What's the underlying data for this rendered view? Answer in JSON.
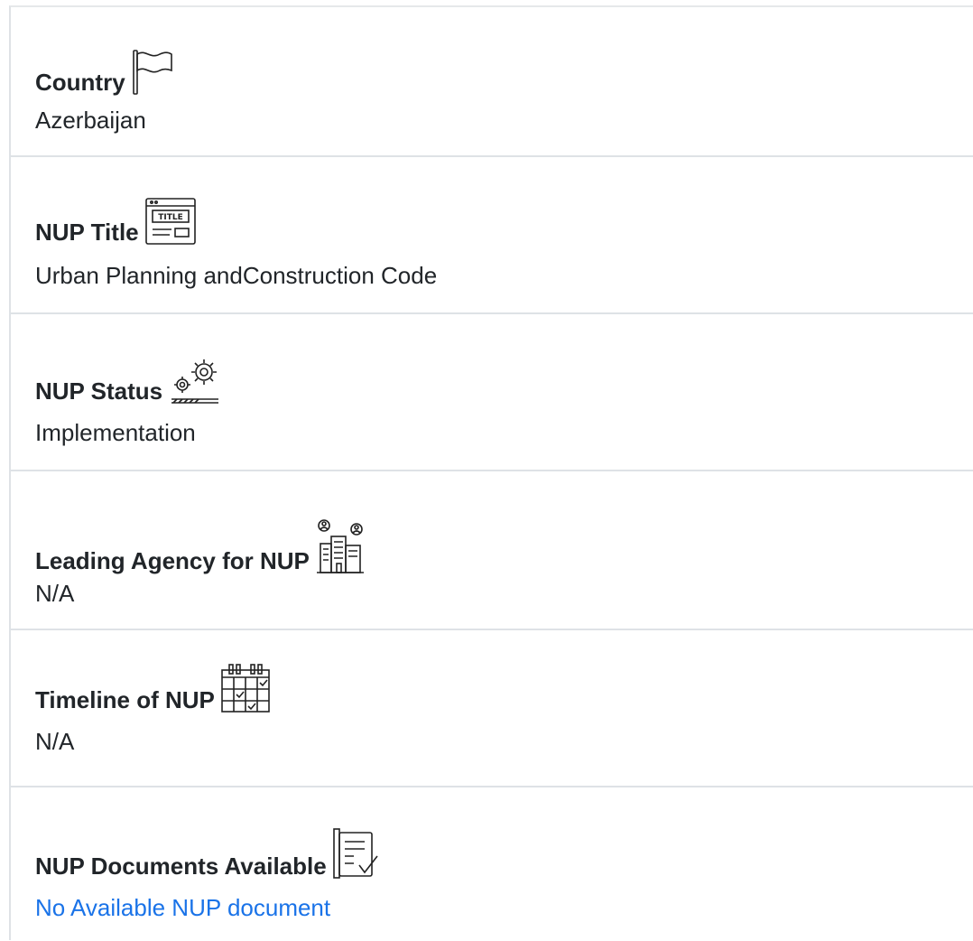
{
  "fields": [
    {
      "label": "Country",
      "icon": "flag-icon",
      "value": "Azerbaijan"
    },
    {
      "label": "NUP Title",
      "icon": "title-icon",
      "value": "Urban Planning andConstruction Code"
    },
    {
      "label": "NUP Status",
      "icon": "gears-status-icon",
      "value": "Implementation"
    },
    {
      "label": "Leading Agency for NUP",
      "icon": "agency-buildings-icon",
      "value": "N/A"
    },
    {
      "label": "Timeline of NUP",
      "icon": "calendar-icon",
      "value": "N/A"
    },
    {
      "label": "NUP Documents Available",
      "icon": "document-check-icon",
      "value": "No Available NUP document"
    }
  ],
  "colors": {
    "text": "#212529",
    "link": "#1a73e8",
    "divider": "#dee2e6"
  }
}
